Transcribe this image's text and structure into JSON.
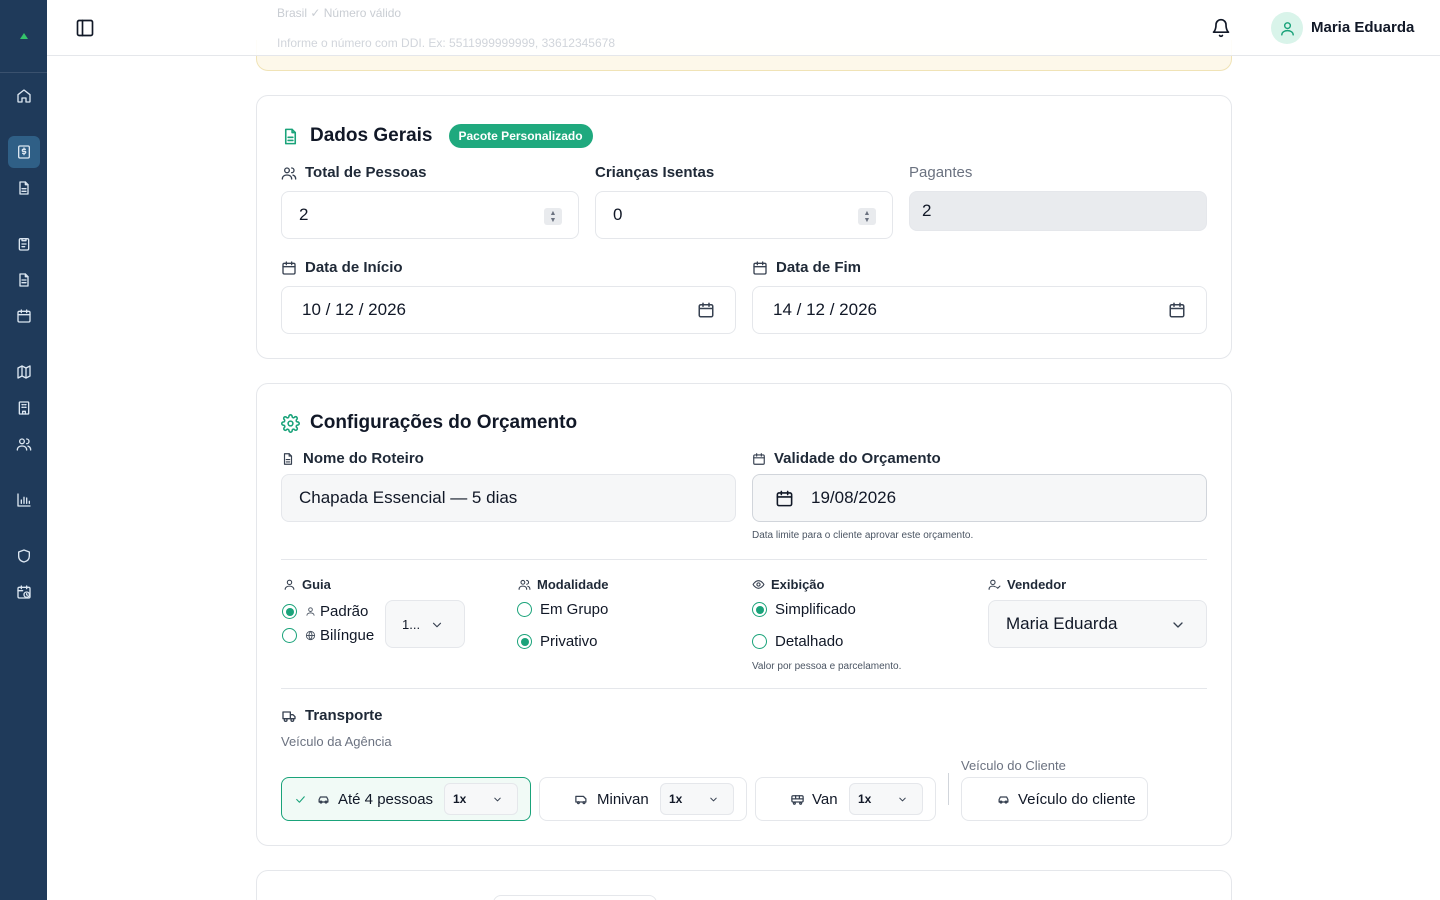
{
  "topbar": {
    "ghost_line1": "Brasil  ✓ Número válido",
    "ghost_line2": "Informe o número com DDI. Ex: 5511999999999, 33612345678",
    "user_name": "Maria Eduarda"
  },
  "sidebar": {
    "items": [
      "home-icon",
      "budget-icon",
      "document-icon",
      "clipboard-icon",
      "file-icon",
      "calendar-icon",
      "map-icon",
      "building-icon",
      "users-icon",
      "chart-icon",
      "shield-icon",
      "calendar-clock-icon"
    ]
  },
  "dados_gerais": {
    "title": "Dados Gerais",
    "badge": "Pacote Personalizado",
    "total_pessoas_label": "Total de Pessoas",
    "total_pessoas_value": "2",
    "criancas_label": "Crianças Isentas",
    "criancas_value": "0",
    "pagantes_label": "Pagantes",
    "pagantes_value": "2",
    "data_inicio_label": "Data de Início",
    "data_inicio_value": "10 / 12 / 2026",
    "data_fim_label": "Data de Fim",
    "data_fim_value": "14 / 12 / 2026"
  },
  "config": {
    "title": "Configurações do Orçamento",
    "nome_roteiro_label": "Nome do Roteiro",
    "nome_roteiro_value": "Chapada Essencial — 5 dias",
    "validade_label": "Validade do Orçamento",
    "validade_value": "19/08/2026",
    "validade_hint": "Data limite para o cliente aprovar este orçamento.",
    "guia": {
      "label": "Guia",
      "options": [
        "Padrão",
        "Bilíngue"
      ],
      "selected": "Padrão",
      "qty_value": "1..."
    },
    "modalidade": {
      "label": "Modalidade",
      "options": [
        "Em Grupo",
        "Privativo"
      ],
      "selected": "Privativo"
    },
    "exibicao": {
      "label": "Exibição",
      "options": [
        "Simplificado",
        "Detalhado"
      ],
      "selected": "Simplificado",
      "hint": "Valor por pessoa e parcelamento."
    },
    "vendedor": {
      "label": "Vendedor",
      "value": "Maria Eduarda"
    },
    "transporte": {
      "label": "Transporte",
      "agencia_label": "Veículo da Agência",
      "cliente_label": "Veículo do Cliente",
      "vehicles": [
        {
          "name": "Até 4 pessoas",
          "qty": "1x",
          "selected": true
        },
        {
          "name": "Minivan",
          "qty": "1x",
          "selected": false
        },
        {
          "name": "Van",
          "qty": "1x",
          "selected": false
        }
      ],
      "cliente_option": "Veículo do cliente"
    }
  },
  "colors": {
    "sidebar": "#1f3a5a",
    "accent": "#1aa37a",
    "badge": "#1fa97e"
  }
}
